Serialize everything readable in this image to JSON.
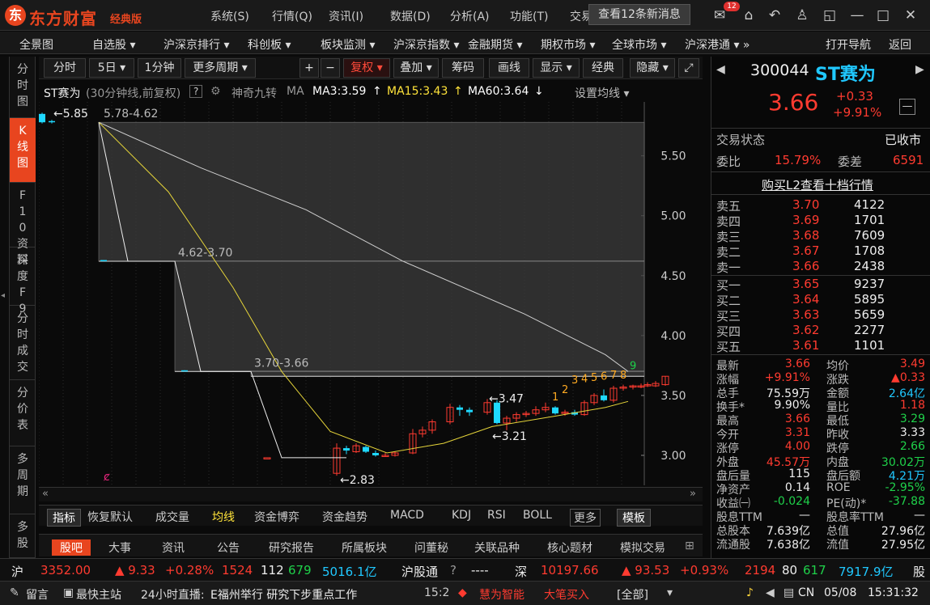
{
  "app": {
    "logo_text": "东方财富",
    "edition": "经典版"
  },
  "top_menu": [
    "系统(S)",
    "行情(Q)",
    "资讯(I)",
    "数据(D)",
    "分析(A)",
    "功能(T)",
    "交易"
  ],
  "news_button": "查看12条新消息",
  "mail_badge": "12",
  "nav": [
    "全景图",
    "自选股 ▾",
    "沪深京排行 ▾",
    "科创板 ▾",
    "板块监测 ▾",
    "沪深京指数 ▾",
    "金融期货 ▾",
    "期权市场 ▾",
    "全球市场 ▾",
    "沪深港通 ▾ »",
    "打开导航",
    "返回"
  ],
  "side_tabs": [
    "分时图",
    "K线图",
    "F10资料",
    "深度F9",
    "分时成交",
    "分价表",
    "多周期",
    "多股"
  ],
  "toolbar": {
    "buttons": [
      "分时",
      "5日 ▾",
      "1分钟",
      "更多周期 ▾",
      "+",
      "−",
      "复权 ▾",
      "叠加 ▾",
      "筹码",
      "画线",
      "显示 ▾",
      "经典",
      "隐藏 ▾",
      "⤢"
    ]
  },
  "chart_info": {
    "name": "ST赛为",
    "desc": "(30分钟线,前复权)",
    "help": "?",
    "jiuzhuan": "神奇九转",
    "ma": "MA",
    "ma3": "MA3:3.59",
    "ma15": "MA15:3.43",
    "ma60": "MA60:3.64",
    "setting": "设置均线 ▾"
  },
  "chart_data": {
    "type": "candlestick",
    "y_ticks": [
      "5.50",
      "5.00",
      "4.50",
      "4.00",
      "3.50",
      "3.00"
    ],
    "ylim": [
      2.75,
      5.95
    ],
    "annotations": {
      "high": "5.85",
      "gap1": "5.78-4.62",
      "gap2": "4.62-3.70",
      "gap3": "3.70-3.66",
      "mid_high": "3.47",
      "mid_low": "3.21",
      "low": "2.83"
    },
    "nine_turn": [
      "1",
      "2",
      "3",
      "4",
      "5",
      "6",
      "7",
      "8",
      "9"
    ],
    "candles": [
      {
        "o": 5.85,
        "c": 5.78,
        "h": 5.86,
        "l": 5.77
      },
      {
        "o": 5.79,
        "c": 5.78,
        "h": 5.8,
        "l": 5.77
      },
      {
        "o": 4.63,
        "c": 4.62,
        "h": 4.63,
        "l": 4.62
      },
      {
        "o": 3.71,
        "c": 3.7,
        "h": 3.71,
        "l": 3.7
      },
      {
        "o": 2.98,
        "c": 2.98,
        "h": 2.98,
        "l": 2.98
      },
      {
        "o": 2.85,
        "c": 3.06,
        "h": 3.1,
        "l": 2.83
      },
      {
        "o": 3.06,
        "c": 3.04,
        "h": 3.08,
        "l": 3.01
      },
      {
        "o": 3.03,
        "c": 3.08,
        "h": 3.1,
        "l": 3.02
      },
      {
        "o": 3.07,
        "c": 3.03,
        "h": 3.08,
        "l": 3.02
      },
      {
        "o": 3.02,
        "c": 3.0,
        "h": 3.04,
        "l": 2.99
      },
      {
        "o": 3.0,
        "c": 3.0,
        "h": 3.02,
        "l": 2.99
      },
      {
        "o": 3.0,
        "c": 3.02,
        "h": 3.03,
        "l": 2.99
      },
      {
        "o": 3.02,
        "c": 3.18,
        "h": 3.22,
        "l": 3.01
      },
      {
        "o": 3.18,
        "c": 3.21,
        "h": 3.24,
        "l": 3.15
      },
      {
        "o": 3.21,
        "c": 3.28,
        "h": 3.3,
        "l": 3.18
      },
      {
        "o": 3.28,
        "c": 3.4,
        "h": 3.43,
        "l": 3.26
      },
      {
        "o": 3.4,
        "c": 3.38,
        "h": 3.42,
        "l": 3.33
      },
      {
        "o": 3.38,
        "c": 3.36,
        "h": 3.4,
        "l": 3.33
      },
      {
        "o": 3.36,
        "c": 3.44,
        "h": 3.47,
        "l": 3.34
      },
      {
        "o": 3.44,
        "c": 3.27,
        "h": 3.46,
        "l": 3.26
      },
      {
        "o": 3.27,
        "c": 3.31,
        "h": 3.33,
        "l": 3.21
      },
      {
        "o": 3.31,
        "c": 3.34,
        "h": 3.36,
        "l": 3.28
      },
      {
        "o": 3.34,
        "c": 3.35,
        "h": 3.37,
        "l": 3.32
      },
      {
        "o": 3.35,
        "c": 3.38,
        "h": 3.41,
        "l": 3.33
      },
      {
        "o": 3.38,
        "c": 3.4,
        "h": 3.44,
        "l": 3.36
      },
      {
        "o": 3.4,
        "c": 3.35,
        "h": 3.41,
        "l": 3.34
      },
      {
        "o": 3.35,
        "c": 3.36,
        "h": 3.38,
        "l": 3.33
      },
      {
        "o": 3.36,
        "c": 3.34,
        "h": 3.38,
        "l": 3.33
      },
      {
        "o": 3.34,
        "c": 3.44,
        "h": 3.46,
        "l": 3.33
      },
      {
        "o": 3.44,
        "c": 3.5,
        "h": 3.52,
        "l": 3.42
      },
      {
        "o": 3.5,
        "c": 3.46,
        "h": 3.55,
        "l": 3.45
      },
      {
        "o": 3.46,
        "c": 3.56,
        "h": 3.58,
        "l": 3.44
      },
      {
        "o": 3.56,
        "c": 3.57,
        "h": 3.59,
        "l": 3.54
      },
      {
        "o": 3.57,
        "c": 3.58,
        "h": 3.59,
        "l": 3.55
      },
      {
        "o": 3.58,
        "c": 3.58,
        "h": 3.6,
        "l": 3.56
      },
      {
        "o": 3.58,
        "c": 3.59,
        "h": 3.61,
        "l": 3.57
      },
      {
        "o": 3.58,
        "c": 3.6,
        "h": 3.62,
        "l": 3.57
      },
      {
        "o": 3.59,
        "c": 3.66,
        "h": 3.66,
        "l": 3.58
      }
    ]
  },
  "subtabs": [
    "指标",
    "恢复默认",
    "成交量",
    "均线",
    "资金博弈",
    "资金趋势",
    "MACD",
    "KDJ",
    "RSI",
    "BOLL",
    "更多",
    "模板"
  ],
  "bottom_tabs": [
    "股吧",
    "大事",
    "资讯",
    "公告",
    "研究报告",
    "所属板块",
    "问董秘",
    "关联品种",
    "核心题材",
    "模拟交易"
  ],
  "quote": {
    "code": "300044",
    "name": "ST赛为",
    "price": "3.66",
    "chg": "+0.33",
    "pct": "+9.91%",
    "status_label": "交易状态",
    "status": "已收市",
    "wb_label": "委比",
    "wb": "15.79%",
    "wc_label": "委差",
    "wc": "6591",
    "l2": "购买L2查看十档行情",
    "asks": [
      {
        "label": "卖五",
        "p": "3.70",
        "v": "4122"
      },
      {
        "label": "卖四",
        "p": "3.69",
        "v": "1701"
      },
      {
        "label": "卖三",
        "p": "3.68",
        "v": "7609"
      },
      {
        "label": "卖二",
        "p": "3.67",
        "v": "1708"
      },
      {
        "label": "卖一",
        "p": "3.66",
        "v": "2438"
      }
    ],
    "bids": [
      {
        "label": "买一",
        "p": "3.65",
        "v": "9237"
      },
      {
        "label": "买二",
        "p": "3.64",
        "v": "5895"
      },
      {
        "label": "买三",
        "p": "3.63",
        "v": "5659"
      },
      {
        "label": "买四",
        "p": "3.62",
        "v": "2277"
      },
      {
        "label": "买五",
        "p": "3.61",
        "v": "1101"
      }
    ],
    "stats": [
      [
        "最新",
        "3.66",
        "均价",
        "3.49"
      ],
      [
        "涨幅",
        "+9.91%",
        "涨跌",
        "▲0.33"
      ],
      [
        "总手",
        "75.59万",
        "金额",
        "2.64亿"
      ],
      [
        "换手*",
        "9.90%",
        "量比",
        "1.18"
      ],
      [
        "最高",
        "3.66",
        "最低",
        "3.29"
      ],
      [
        "今开",
        "3.31",
        "昨收",
        "3.33"
      ],
      [
        "涨停",
        "4.00",
        "跌停",
        "2.66"
      ],
      [
        "外盘",
        "45.57万",
        "内盘",
        "30.02万"
      ],
      [
        "盘后量",
        "115",
        "盘后额",
        "4.21万"
      ],
      [
        "净资产",
        "0.14",
        "ROE",
        "-2.95%"
      ],
      [
        "收益㈠",
        "-0.024",
        "PE(动)*",
        "-37.88"
      ],
      [
        "股息TTM",
        "—",
        "股息率TTM",
        "—"
      ],
      [
        "总股本",
        "7.639亿",
        "总值",
        "27.96亿"
      ],
      [
        "流通股",
        "7.638亿",
        "流值",
        "27.95亿"
      ]
    ]
  },
  "ticker": {
    "sh": "沪",
    "sh_idx": "3352.00",
    "sh_chg": "▲ 9.33",
    "sh_pct": "+0.28%",
    "sh_up": "1524",
    "sh_flat": "112",
    "sh_dn": "679",
    "sh_amt": "5016.1亿",
    "hgt": "沪股通",
    "hgt_val": "----",
    "sz": "深",
    "sz_idx": "10197.66",
    "sz_chg": "▲ 93.53",
    "sz_pct": "+0.93%",
    "sz_up": "2194",
    "sz_flat": "80",
    "sz_dn": "617",
    "sz_amt": "7917.9亿",
    "gu": "股"
  },
  "status": {
    "msg": "留言",
    "site": "最快主站",
    "live": "24小时直播:",
    "news": "E福州举行 研究下步重点工作",
    "time1": "15:2",
    "hot1": "慧为智能",
    "hot2": "大笔买入",
    "all": "[全部]",
    "cn": "CN",
    "date": "05/08",
    "clock": "15:31:32"
  }
}
